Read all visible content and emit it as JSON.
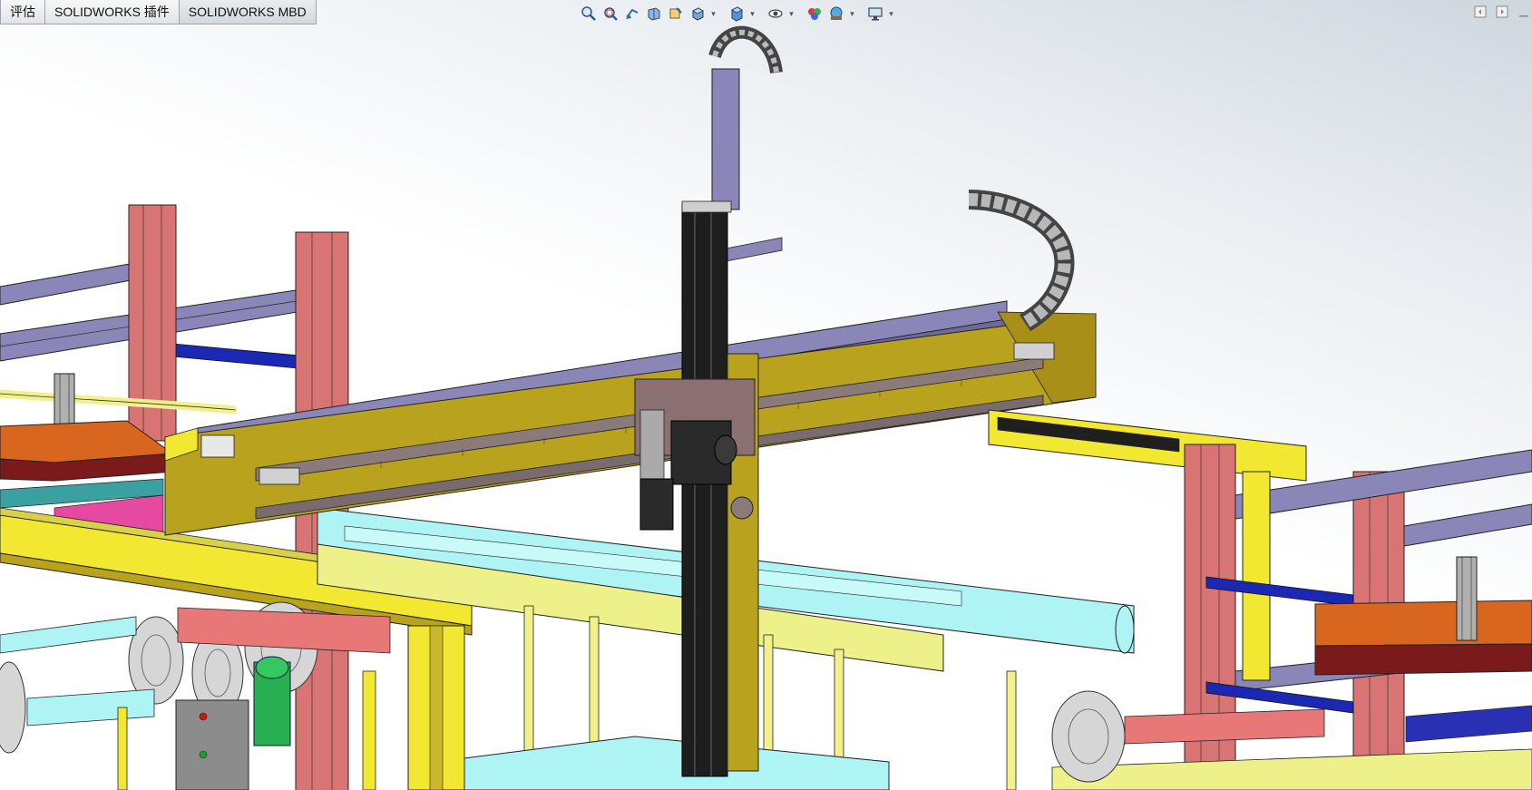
{
  "tabs": [
    {
      "id": "evaluate",
      "label": "评估"
    },
    {
      "id": "addins",
      "label": "SOLIDWORKS 插件"
    },
    {
      "id": "mbd",
      "label": "SOLIDWORKS MBD"
    }
  ],
  "heads_up_toolbar": [
    {
      "name": "zoom-to-fit-icon",
      "dropdown": false
    },
    {
      "name": "zoom-to-area-icon",
      "dropdown": false
    },
    {
      "name": "previous-view-icon",
      "dropdown": false
    },
    {
      "name": "section-view-icon",
      "dropdown": false
    },
    {
      "name": "dynamic-annotation-icon",
      "dropdown": false
    },
    {
      "name": "view-orientation-icon",
      "dropdown": true
    },
    {
      "name": "display-style-icon",
      "dropdown": true
    },
    {
      "name": "hide-show-items-icon",
      "dropdown": true
    },
    {
      "name": "edit-appearance-icon",
      "dropdown": false
    },
    {
      "name": "apply-scene-icon",
      "dropdown": true
    },
    {
      "name": "view-settings-icon",
      "dropdown": true
    }
  ],
  "window_controls": [
    "restore-left-icon",
    "restore-right-icon",
    "minimize-icon"
  ],
  "colors": {
    "frame_yellow": "#f2e832",
    "dark_yellow": "#b8a21e",
    "post_red": "#d87474",
    "profile_purple": "#8a86b8",
    "conveyor_cyan": "#aef4f4",
    "rod_blue": "#1a28b4",
    "chain_gray": "#6c6c6c",
    "plate_orange": "#d8661e",
    "motor_green": "#28b050"
  }
}
